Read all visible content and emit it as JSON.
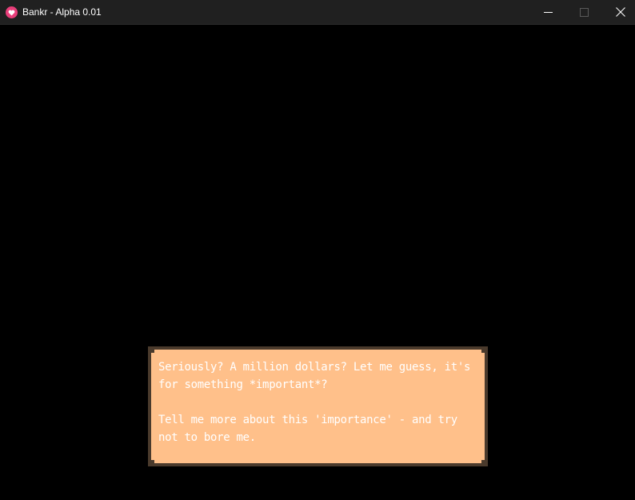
{
  "window": {
    "title": "Bankr - Alpha 0.01",
    "icon": "heart-app-icon",
    "controls": {
      "minimize": "minimize-icon",
      "maximize": "maximize-icon",
      "close": "close-icon"
    }
  },
  "dialog": {
    "paragraph1": "Seriously? A million dollars? Let me guess, it's for something *important*?",
    "paragraph2": "Tell me more about this 'importance' - and try not to bore me."
  },
  "colors": {
    "titlebar": "#202020",
    "background": "#000000",
    "dialog_fill": "#ffc08a",
    "dialog_border": "#4a3a2c",
    "dialog_text": "#ffffff",
    "app_icon": "#e83e7a"
  }
}
